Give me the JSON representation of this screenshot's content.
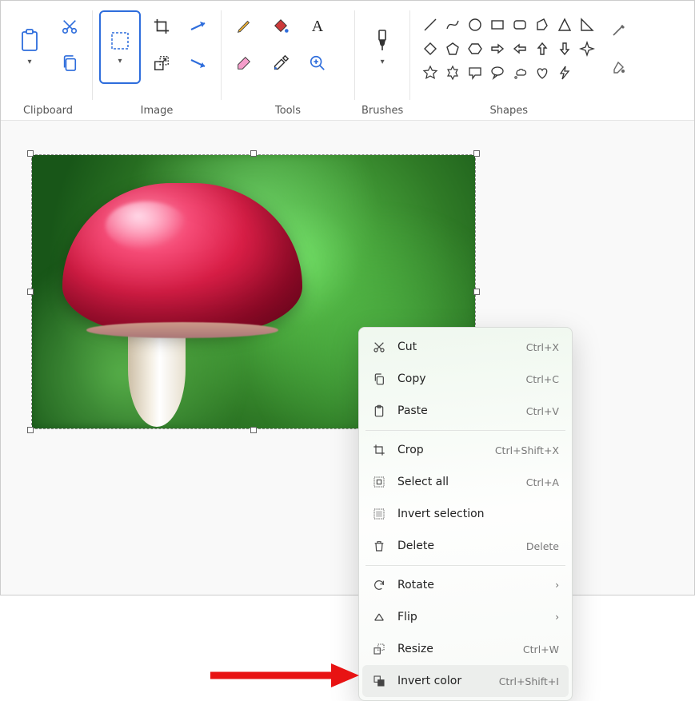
{
  "ribbon": {
    "groups": {
      "clipboard": "Clipboard",
      "image": "Image",
      "tools": "Tools",
      "brushes": "Brushes",
      "shapes": "Shapes"
    }
  },
  "context_menu": {
    "items": [
      {
        "icon": "cut",
        "label": "Cut",
        "shortcut": "Ctrl+X"
      },
      {
        "icon": "copy",
        "label": "Copy",
        "shortcut": "Ctrl+C"
      },
      {
        "icon": "paste",
        "label": "Paste",
        "shortcut": "Ctrl+V"
      },
      {
        "sep": true
      },
      {
        "icon": "crop",
        "label": "Crop",
        "shortcut": "Ctrl+Shift+X"
      },
      {
        "icon": "select-all",
        "label": "Select all",
        "shortcut": "Ctrl+A"
      },
      {
        "icon": "invert-sel",
        "label": "Invert selection",
        "shortcut": ""
      },
      {
        "icon": "delete",
        "label": "Delete",
        "shortcut": "Delete"
      },
      {
        "sep": true
      },
      {
        "icon": "rotate",
        "label": "Rotate",
        "submenu": true
      },
      {
        "icon": "flip",
        "label": "Flip",
        "submenu": true
      },
      {
        "icon": "resize",
        "label": "Resize",
        "shortcut": "Ctrl+W"
      },
      {
        "icon": "invert-color",
        "label": "Invert color",
        "shortcut": "Ctrl+Shift+I",
        "hovered": true
      }
    ]
  }
}
